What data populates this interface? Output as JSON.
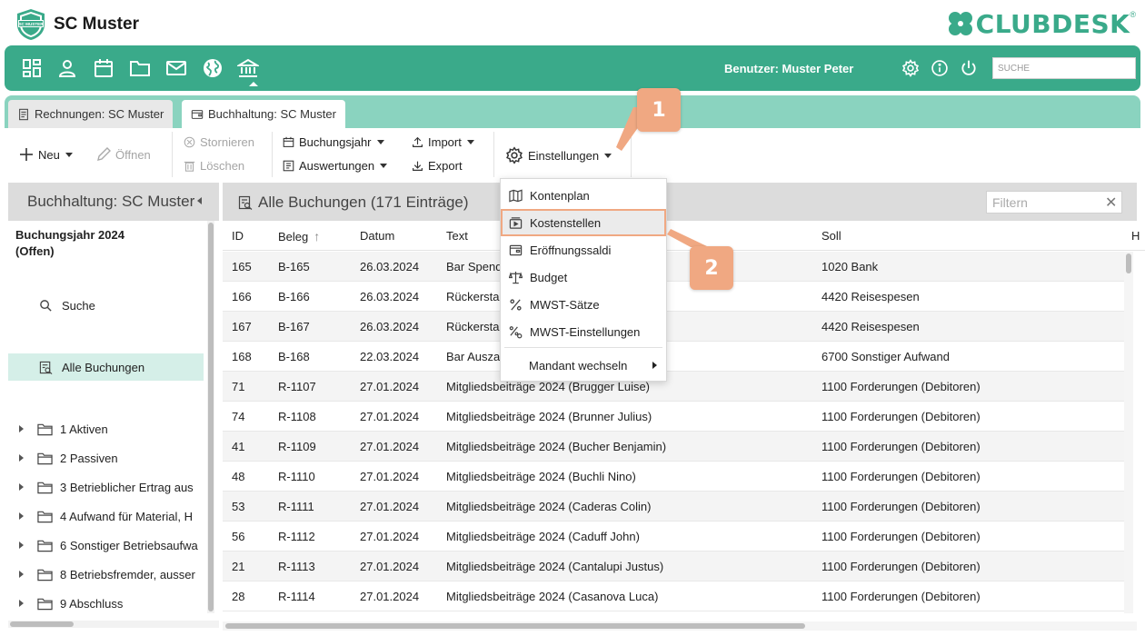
{
  "app": {
    "club_name": "SC Muster",
    "club_logo_text": "SC MUSTER",
    "brand": "CLUBDESK",
    "brand_reg": "®"
  },
  "mainnav": {
    "icons": [
      "dashboard-icon",
      "person-icon",
      "calendar-icon",
      "folder-icon",
      "mail-icon",
      "globe-icon",
      "bank-icon"
    ],
    "active": "bank-icon",
    "user_label": "Benutzer: Muster Peter",
    "search_placeholder": "SUCHE"
  },
  "tabs": [
    {
      "label": "Rechnungen: SC Muster",
      "active": false
    },
    {
      "label": "Buchhaltung: SC Muster",
      "active": true
    }
  ],
  "toolbar": {
    "new_label": "Neu",
    "open_label": "Öffnen",
    "cancel_label": "Stornieren",
    "delete_label": "Löschen",
    "fiscal_year_label": "Buchungsjahr",
    "reports_label": "Auswertungen",
    "import_label": "Import",
    "export_label": "Export",
    "settings_label": "Einstellungen"
  },
  "sidebar": {
    "title": "Buchhaltung: SC Muster",
    "year_line1": "Buchungsjahr 2024",
    "year_line2": "(Offen)",
    "search_label": "Suche",
    "all_bookings_label": "Alle Buchungen",
    "tree": [
      "1 Aktiven",
      "2 Passiven",
      "3 Betrieblicher Ertrag aus",
      "4 Aufwand für Material, H",
      "6 Sonstiger Betriebsaufwa",
      "8 Betriebsfremder, ausser",
      "9 Abschluss"
    ]
  },
  "content": {
    "title": "Alle Buchungen (171 Einträge)",
    "filter_placeholder": "Filtern",
    "filter_clear": "✕",
    "columns": {
      "id": "ID",
      "beleg": "Beleg",
      "datum": "Datum",
      "text": "Text",
      "soll": "Soll",
      "haben": "H"
    },
    "rows": [
      {
        "id": "165",
        "beleg": "B-165",
        "datum": "26.03.2024",
        "text": "Bar Spend",
        "soll": "1020 Bank"
      },
      {
        "id": "166",
        "beleg": "B-166",
        "datum": "26.03.2024",
        "text": "Rückersta",
        "soll": "4420 Reisespesen"
      },
      {
        "id": "167",
        "beleg": "B-167",
        "datum": "26.03.2024",
        "text": "Rückersta",
        "soll": "4420 Reisespesen"
      },
      {
        "id": "168",
        "beleg": "B-168",
        "datum": "22.03.2024",
        "text": "Bar Ausza",
        "soll": "6700 Sonstiger Aufwand"
      },
      {
        "id": "71",
        "beleg": "R-1107",
        "datum": "27.01.2024",
        "text": "Mitgliedsbeiträge 2024 (Brugger Luise)",
        "soll": "1100 Forderungen (Debitoren)"
      },
      {
        "id": "74",
        "beleg": "R-1108",
        "datum": "27.01.2024",
        "text": "Mitgliedsbeiträge 2024 (Brunner Julius)",
        "soll": "1100 Forderungen (Debitoren)"
      },
      {
        "id": "41",
        "beleg": "R-1109",
        "datum": "27.01.2024",
        "text": "Mitgliedsbeiträge 2024 (Bucher Benjamin)",
        "soll": "1100 Forderungen (Debitoren)"
      },
      {
        "id": "48",
        "beleg": "R-1110",
        "datum": "27.01.2024",
        "text": "Mitgliedsbeiträge 2024 (Buchli Nino)",
        "soll": "1100 Forderungen (Debitoren)"
      },
      {
        "id": "53",
        "beleg": "R-1111",
        "datum": "27.01.2024",
        "text": "Mitgliedsbeiträge 2024 (Caderas Colin)",
        "soll": "1100 Forderungen (Debitoren)"
      },
      {
        "id": "56",
        "beleg": "R-1112",
        "datum": "27.01.2024",
        "text": "Mitgliedsbeiträge 2024 (Caduff John)",
        "soll": "1100 Forderungen (Debitoren)"
      },
      {
        "id": "21",
        "beleg": "R-1113",
        "datum": "27.01.2024",
        "text": "Mitgliedsbeiträge 2024 (Cantalupi Justus)",
        "soll": "1100 Forderungen (Debitoren)"
      },
      {
        "id": "28",
        "beleg": "R-1114",
        "datum": "27.01.2024",
        "text": "Mitgliedsbeiträge 2024 (Casanova Luca)",
        "soll": "1100 Forderungen (Debitoren)"
      }
    ]
  },
  "settings_menu": {
    "items": [
      {
        "label": "Kontenplan",
        "icon": "map-icon"
      },
      {
        "label": "Kostenstellen",
        "icon": "cost-center-icon",
        "highlighted": true
      },
      {
        "label": "Eröffnungssaldi",
        "icon": "wallet-icon"
      },
      {
        "label": "Budget",
        "icon": "scale-icon"
      },
      {
        "label": "MWST-Sätze",
        "icon": "percent-icon"
      },
      {
        "label": "MWST-Einstellungen",
        "icon": "percent-settings-icon"
      }
    ],
    "submenu_label": "Mandant wechseln"
  },
  "callouts": [
    "1",
    "2"
  ],
  "colors": {
    "accent": "#3aaa8a",
    "tabs_bar": "#8ad3bf",
    "callout": "#f0a882",
    "selected": "#d5efe8"
  }
}
